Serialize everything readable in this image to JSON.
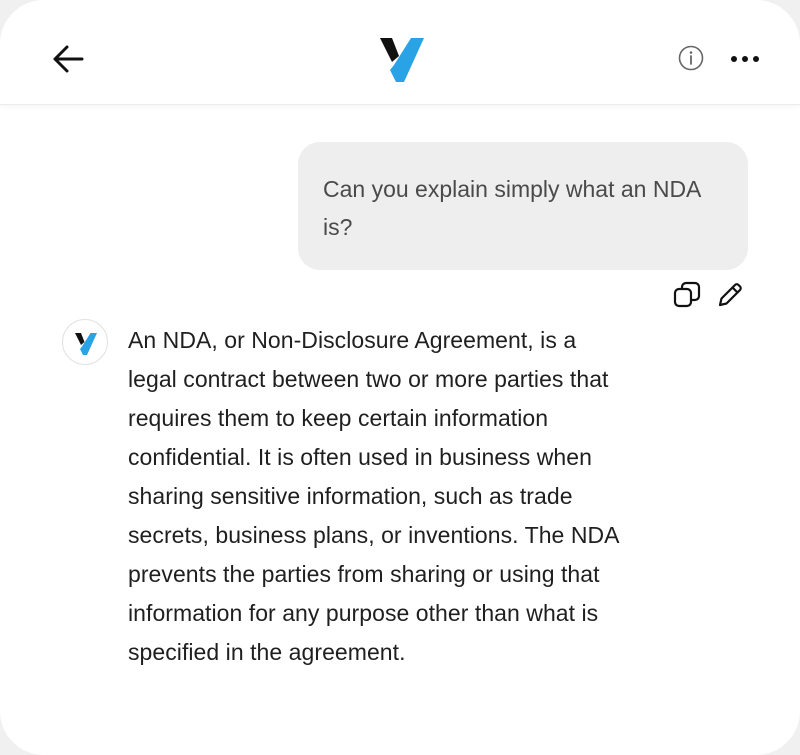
{
  "header": {
    "back_icon": "arrow-left-icon",
    "logo_icon": "v-logo-icon",
    "info_icon": "info-circle-icon",
    "more_icon": "more-horizontal-icon"
  },
  "conversation": {
    "user_message": "Can you explain simply what an NDA is?",
    "user_message_actions": {
      "copy_icon": "copy-icon",
      "edit_icon": "pencil-icon"
    },
    "assistant_message": "An NDA, or Non-Disclosure Agreement, is a legal contract between two or more parties that requires them to keep certain information confidential. It is often used in business when sharing sensitive information, such as trade secrets, business plans, or inventions. The NDA prevents the parties from sharing or using that information for any purpose other than what is specified in the agreement."
  },
  "colors": {
    "logo_dark": "#111111",
    "logo_blue": "#2aa3e6",
    "user_bubble_bg": "#eeeeee",
    "user_text": "#4a4a4a",
    "assistant_text": "#1f1f1f"
  }
}
